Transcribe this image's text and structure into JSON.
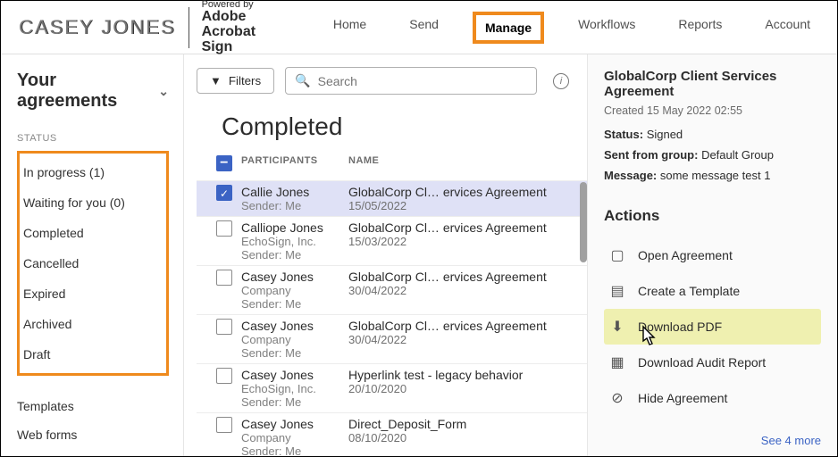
{
  "logo_text": "CASEY JONES",
  "powered": {
    "small": "Powered by",
    "line1": "Adobe",
    "line2": "Acrobat Sign"
  },
  "nav": [
    {
      "label": "Home",
      "active": false
    },
    {
      "label": "Send",
      "active": false
    },
    {
      "label": "Manage",
      "active": true
    },
    {
      "label": "Workflows",
      "active": false
    },
    {
      "label": "Reports",
      "active": false
    },
    {
      "label": "Account",
      "active": false
    }
  ],
  "sidebar": {
    "title": "Your agreements",
    "status_heading": "STATUS",
    "status_items": [
      "In progress (1)",
      "Waiting for you (0)",
      "Completed",
      "Cancelled",
      "Expired",
      "Archived",
      "Draft"
    ],
    "other_items": [
      "Templates",
      "Web forms"
    ]
  },
  "center": {
    "filters_label": "Filters",
    "search_placeholder": "Search",
    "heading": "Completed",
    "columns": {
      "participants": "PARTICIPANTS",
      "name": "NAME"
    },
    "rows": [
      {
        "selected": true,
        "participant": "Callie Jones",
        "sender": "Sender: Me",
        "agreement": "GlobalCorp Cl… ervices Agreement",
        "date": "15/05/2022"
      },
      {
        "selected": false,
        "participant": "Calliope Jones",
        "sub": "EchoSign, Inc.",
        "sender": "Sender: Me",
        "agreement": "GlobalCorp Cl… ervices Agreement",
        "date": "15/03/2022"
      },
      {
        "selected": false,
        "participant": "Casey Jones",
        "sub": "Company",
        "sender": "Sender: Me",
        "agreement": "GlobalCorp Cl… ervices Agreement",
        "date": "30/04/2022"
      },
      {
        "selected": false,
        "participant": "Casey Jones",
        "sub": "Company",
        "sender": "Sender: Me",
        "agreement": "GlobalCorp Cl… ervices Agreement",
        "date": "30/04/2022"
      },
      {
        "selected": false,
        "participant": "Casey Jones",
        "sub": "EchoSign, Inc.",
        "sender": "Sender: Me",
        "agreement": "Hyperlink test - legacy behavior",
        "date": "20/10/2020"
      },
      {
        "selected": false,
        "participant": "Casey Jones",
        "sub": "Company",
        "sender": "Sender: Me",
        "agreement": "Direct_Deposit_Form",
        "date": "08/10/2020"
      }
    ]
  },
  "right": {
    "title": "GlobalCorp Client Services Agreement",
    "created": "Created 15 May 2022 02:55",
    "status_label": "Status:",
    "status_value": "Signed",
    "group_label": "Sent from group:",
    "group_value": "Default Group",
    "message_label": "Message:",
    "message_value": "some message test 1",
    "actions_heading": "Actions",
    "actions": [
      {
        "icon": "open",
        "label": "Open Agreement",
        "highlight": false
      },
      {
        "icon": "template",
        "label": "Create a Template",
        "highlight": false
      },
      {
        "icon": "download",
        "label": "Download PDF",
        "highlight": true
      },
      {
        "icon": "report",
        "label": "Download Audit Report",
        "highlight": false
      },
      {
        "icon": "hide",
        "label": "Hide Agreement",
        "highlight": false
      }
    ],
    "see_more": "See 4 more"
  },
  "icons": {
    "open": "▢",
    "template": "▤",
    "download": "⬇",
    "report": "▦",
    "hide": "⊘"
  }
}
